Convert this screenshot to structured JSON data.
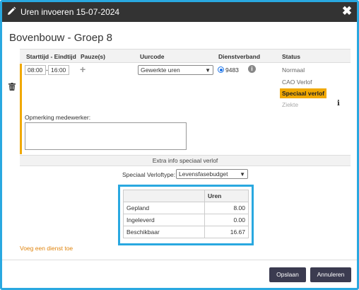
{
  "dialog": {
    "title": "Uren invoeren 15-07-2024",
    "heading": "Bovenbouw - Groep 8"
  },
  "columns": {
    "time": "Starttijd - Eindtijd",
    "pause": "Pauze(s)",
    "uurcode": "Uurcode",
    "dienst": "Dienstverband",
    "status": "Status"
  },
  "row": {
    "start": "08:00",
    "dash": "-",
    "end": "16:00",
    "uurcode": "Gewerkte uren",
    "dienst_number": "9483",
    "statuses": [
      "Normaal",
      "CAO Verlof",
      "Speciaal verlof",
      "Ziekte"
    ]
  },
  "remark": {
    "label": "Opmerking medewerker:"
  },
  "extra": {
    "heading": "Extra info speciaal verlof",
    "verlof_label": "Speciaal Verloftype:",
    "verlof_value": "Levensfasebudget"
  },
  "table": {
    "header": "Uren",
    "rows": [
      {
        "label": "Gepland",
        "value": "8.00"
      },
      {
        "label": "Ingeleverd",
        "value": "0.00"
      },
      {
        "label": "Beschikbaar",
        "value": "16.67"
      }
    ]
  },
  "add_link": "Voeg een dienst toe",
  "buttons": {
    "save": "Opslaan",
    "cancel": "Annuleren"
  },
  "colors": {
    "accent": "#f0a800",
    "highlight": "#29a8e0",
    "titlebar": "#333333",
    "button": "#3b3b50",
    "link": "#e0850f"
  }
}
